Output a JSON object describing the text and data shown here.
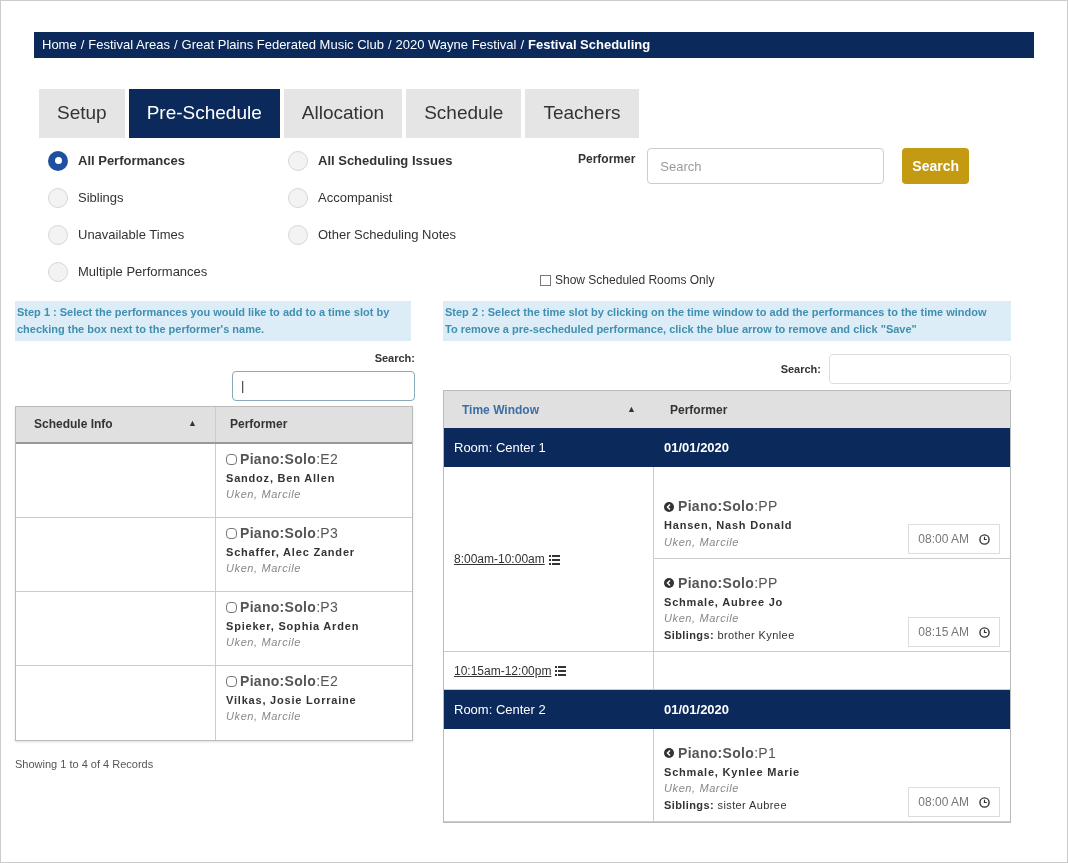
{
  "breadcrumb": [
    {
      "label": "Home",
      "current": false
    },
    {
      "label": "Festival Areas",
      "current": false
    },
    {
      "label": "Great Plains Federated Music Club",
      "current": false
    },
    {
      "label": "2020 Wayne Festival",
      "current": false
    },
    {
      "label": "Festival Scheduling",
      "current": true
    }
  ],
  "separator": "/",
  "tabs": [
    {
      "label": "Setup",
      "selected": false
    },
    {
      "label": "Pre-Schedule",
      "selected": true
    },
    {
      "label": "Allocation",
      "selected": false
    },
    {
      "label": "Schedule",
      "selected": false
    },
    {
      "label": "Teachers",
      "selected": false
    }
  ],
  "filters": [
    [
      {
        "label": "All Performances",
        "kind": "group",
        "selected": true
      },
      {
        "label": "Siblings",
        "kind": "item",
        "selected": false
      },
      {
        "label": "Unavailable Times",
        "kind": "item",
        "selected": false
      },
      {
        "label": "Multiple Performances",
        "kind": "item",
        "selected": false
      }
    ],
    [
      {
        "label": "All Scheduling Issues",
        "kind": "group",
        "selected": false
      },
      {
        "label": "Accompanist",
        "kind": "item",
        "selected": false
      },
      {
        "label": "Other Scheduling Notes",
        "kind": "item",
        "selected": false
      }
    ]
  ],
  "performer_search": {
    "label": "Performer",
    "placeholder": "Search",
    "button": "Search"
  },
  "show_scheduled_rooms_only": {
    "label": "Show Scheduled Rooms Only",
    "checked": false
  },
  "step1": {
    "instructions": "Step 1 : Select the performances you would like to add to a time slot by checking the box next to the performer's name.",
    "search_label": "Search:",
    "search_value": "|",
    "columns": [
      "Schedule Info",
      "Performer"
    ],
    "sort_indicator": "▲",
    "rows": [
      {
        "performance": "**Piano:Solo**:E2",
        "name": "Sandoz, Ben Allen",
        "teacher": "Uken, Marcile",
        "checked": false
      },
      {
        "performance": "**Piano:Solo**:P3",
        "name": "Schaffer, Alec Zander",
        "teacher": "Uken, Marcile",
        "checked": false
      },
      {
        "performance": "**Piano:Solo**:P3",
        "name": "Spieker, Sophia Arden",
        "teacher": "Uken, Marcile",
        "checked": false
      },
      {
        "performance": "**Piano:Solo**:E2",
        "name": "Vilkas, Josie Lorraine",
        "teacher": "Uken, Marcile",
        "checked": false
      }
    ],
    "footer": "Showing 1 to 4 of 4 Records"
  },
  "step2": {
    "instructions": [
      "Step 2 : Select the time slot by clicking on the time window to add the performances to the time window",
      "To remove a pre-secheduled performance, click the blue arrow to remove and click \"Save\""
    ],
    "search_label": "Search:",
    "columns": [
      "Time Window",
      "Performer"
    ],
    "sort_indicator": "▲",
    "rooms": [
      {
        "room": "Room: Center 1",
        "date": "01/01/2020",
        "slots": [
          {
            "time_window": "8:00am-10:00am",
            "performances": [
              {
                "performance": "**Piano:Solo**:PP",
                "name": "Hansen, Nash Donald",
                "teacher": "Uken, Marcile",
                "time": "08:00 AM"
              },
              {
                "performance": "**Piano:Solo**:PP",
                "name": "Schmale, Aubree Jo",
                "teacher": "Uken, Marcile",
                "siblings": "**Siblings:** brother Kynlee",
                "time": "08:15 AM"
              }
            ]
          },
          {
            "time_window": "10:15am-12:00pm"
          }
        ]
      },
      {
        "room": "Room: Center 2",
        "date": "01/01/2020",
        "slots": [
          {
            "performances": [
              {
                "performance": "**Piano:Solo**:P1",
                "name": "Schmale, Kynlee Marie",
                "teacher": "Uken, Marcile",
                "siblings": "**Siblings:** sister Aubree",
                "time": "08:00 AM"
              }
            ]
          }
        ]
      }
    ]
  }
}
